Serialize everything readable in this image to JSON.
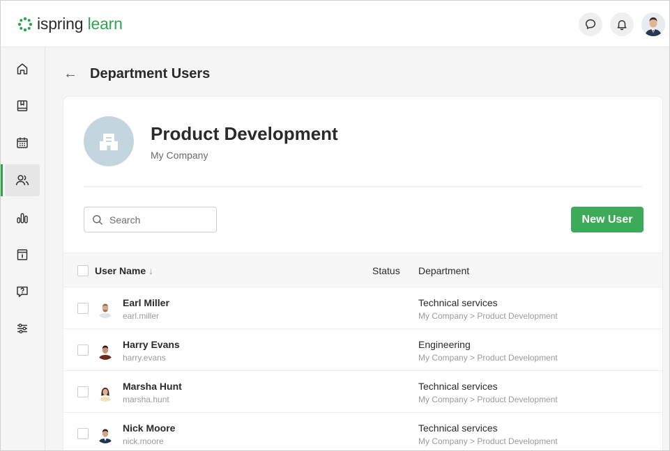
{
  "app": {
    "logo_word1": "ispring",
    "logo_word2": "learn",
    "brand_color": "#2fa44f",
    "icons": [
      "chat-icon",
      "bell-icon"
    ]
  },
  "sidebar": {
    "items": [
      {
        "icon": "home-icon"
      },
      {
        "icon": "book-icon"
      },
      {
        "icon": "calendar-icon"
      },
      {
        "icon": "users-icon",
        "active": true
      },
      {
        "icon": "chart-icon"
      },
      {
        "icon": "info-icon"
      },
      {
        "icon": "question-icon"
      },
      {
        "icon": "settings-sliders-icon"
      }
    ]
  },
  "header": {
    "back_icon": "←",
    "title": "Department Users"
  },
  "department": {
    "name": "Product Development",
    "company": "My Company"
  },
  "toolbar": {
    "search_placeholder": "Search",
    "new_user_label": "New User"
  },
  "table": {
    "columns": {
      "user_name": "User Name",
      "sort_indicator": "↓",
      "status": "Status",
      "department": "Department"
    },
    "rows": [
      {
        "name": "Earl Miller",
        "login": "earl.miller",
        "status": "",
        "department": "Technical services",
        "path": "My Company > Product Development"
      },
      {
        "name": "Harry Evans",
        "login": "harry.evans",
        "status": "",
        "department": "Engineering",
        "path": "My Company > Product Development"
      },
      {
        "name": "Marsha Hunt",
        "login": "marsha.hunt",
        "status": "",
        "department": "Technical services",
        "path": "My Company > Product Development"
      },
      {
        "name": "Nick Moore",
        "login": "nick.moore",
        "status": "",
        "department": "Technical services",
        "path": "My Company > Product Development"
      }
    ]
  }
}
